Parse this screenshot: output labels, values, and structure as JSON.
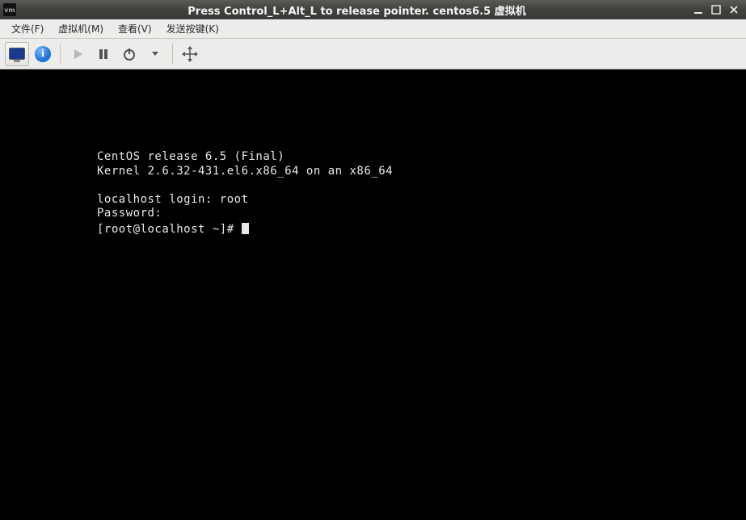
{
  "titlebar": {
    "text": "Press Control_L+Alt_L to release pointer. centos6.5 虚拟机"
  },
  "menubar": {
    "items": [
      "文件(F)",
      "虚拟机(M)",
      "查看(V)",
      "发送按键(K)"
    ]
  },
  "console": {
    "line1": "CentOS release 6.5 (Final)",
    "line2": "Kernel 2.6.32-431.el6.x86_64 on an x86_64",
    "login_prompt": "localhost login: ",
    "login_value": "root",
    "password_prompt": "Password:",
    "shell_prompt": "[root@localhost ~]# "
  }
}
